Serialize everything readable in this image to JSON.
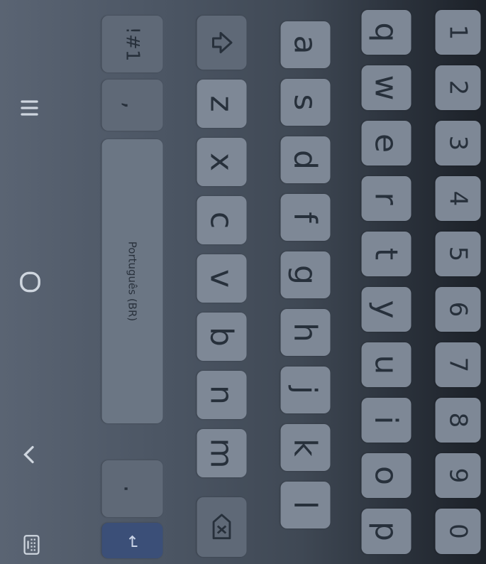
{
  "keyboard": {
    "number_row": [
      "1",
      "2",
      "3",
      "4",
      "5",
      "6",
      "7",
      "8",
      "9",
      "0"
    ],
    "row1": [
      "q",
      "w",
      "e",
      "r",
      "t",
      "y",
      "u",
      "i",
      "o",
      "p"
    ],
    "row2": [
      "a",
      "s",
      "d",
      "f",
      "g",
      "h",
      "j",
      "k",
      "l"
    ],
    "row3": [
      "z",
      "x",
      "c",
      "v",
      "b",
      "n",
      "m"
    ],
    "symbols_label": "!#1",
    "comma_label": ",",
    "space_label": "Português (BR)",
    "period_label": "."
  },
  "icons": {
    "shift": "shift-icon",
    "backspace": "backspace-icon",
    "enter": "enter-icon",
    "hide_keyboard": "chevron-down-icon",
    "recent_apps": "recent-apps-icon",
    "home": "home-icon",
    "back": "back-icon",
    "keyboard_switch": "keyboard-icon"
  },
  "colors": {
    "key": "#7e8896",
    "modifier_key": "#5f6977",
    "accent": "#3b4f78",
    "nav_bar": "#1c2128"
  }
}
